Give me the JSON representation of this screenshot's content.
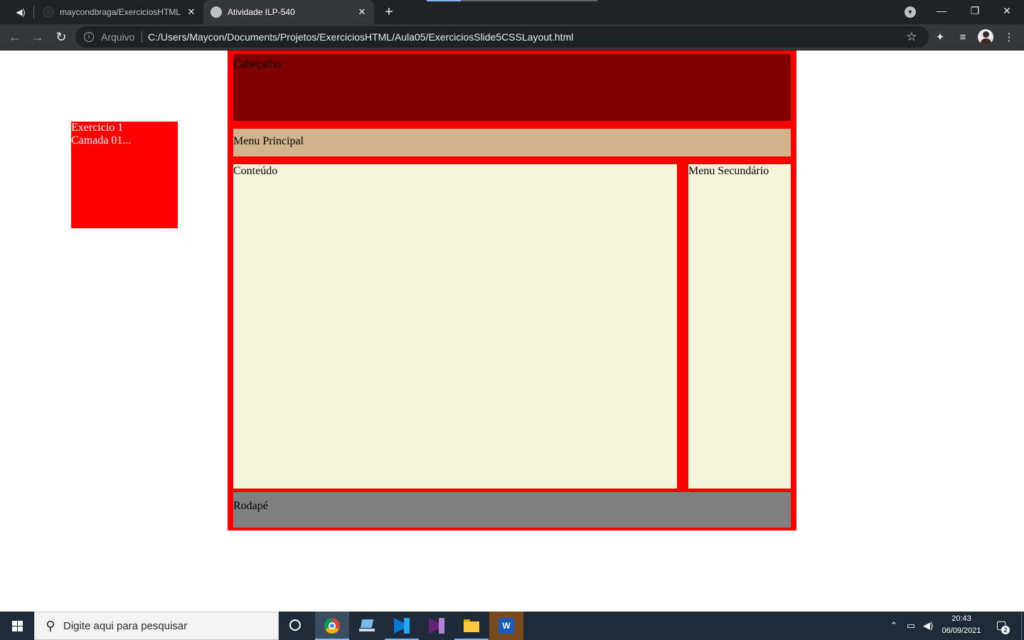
{
  "browser": {
    "tabs": [
      {
        "title": "maycondbraga/ExerciciosHTML: E",
        "active": false
      },
      {
        "title": "Atividade ILP-540",
        "active": true
      }
    ],
    "address": {
      "security_label": "Arquivo",
      "url": "C:/Users/Maycon/Documents/Projetos/ExerciciosHTML/Aula05/ExerciciosSlide5CSSLayout.html"
    }
  },
  "page": {
    "floating_box": {
      "line1": "Exercicio 1",
      "line2": "Camada 01..."
    },
    "layout": {
      "header": "Cabeçalho",
      "menu": "Menu Principal",
      "content": "Conteúdo",
      "sidebar": "Menu Secundário",
      "footer": "Rodapé"
    },
    "colors": {
      "frame": "#ff0000",
      "header": "#800000",
      "menu": "#d2b48c",
      "content": "#f5f5dc",
      "footer": "#808080"
    }
  },
  "taskbar": {
    "search_placeholder": "Digite aqui para pesquisar",
    "apps": [
      "chrome-icon",
      "laptop-icon",
      "vscode-icon",
      "visual-studio-icon",
      "file-explorer-icon",
      "word-icon"
    ],
    "clock": {
      "time": "20:43",
      "date": "06/09/2021"
    },
    "notification_count": "2"
  }
}
